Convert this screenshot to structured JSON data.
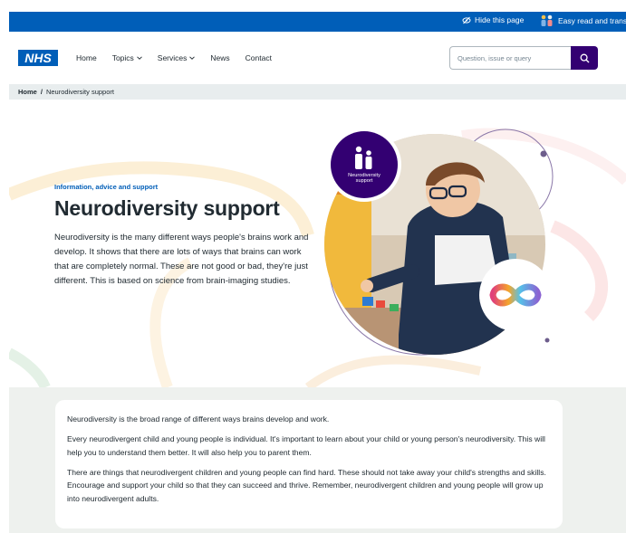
{
  "topbar": {
    "hide_label": "Hide this page",
    "easy_read_label": "Easy read and translat"
  },
  "header": {
    "logo_text": "NHS",
    "nav": [
      "Home",
      "Topics",
      "Services",
      "News",
      "Contact"
    ],
    "search_placeholder": "Question, issue or query"
  },
  "breadcrumb": {
    "home": "Home",
    "separator": "/",
    "current": "Neurodiversity support"
  },
  "hero": {
    "kicker": "Information, advice and support",
    "title": "Neurodiversity support",
    "lead": "Neurodiversity is the many different ways people's brains work and develop. It shows that there are lots of ways that brains can work that are completely normal. These are not good or bad, they're just different. This is based on science from brain-imaging studies.",
    "badge_label": "Neurodiversity support"
  },
  "content": {
    "paragraphs": [
      "Neurodiversity is the broad range of different ways brains develop and work.",
      "Every neurodivergent child and young people is individual. It's important to learn about your child or young person's neurodiversity. This will help you to understand them better. It will also help you to parent them.",
      "There are things that neurodivergent children and young people can find hard. These should not take away your child's strengths and skills. Encourage and support your child so that they can succeed and thrive.  Remember, neurodivergent children and young people will grow up into neurodivergent adults."
    ]
  },
  "colors": {
    "nhs_blue": "#005eb8",
    "purple": "#330072",
    "breadcrumb_bg": "#e8edee",
    "lower_bg": "#eef1ee"
  },
  "icons": [
    "eye-slash-icon",
    "people-icon",
    "chevron-down-icon",
    "search-icon",
    "neurodiversity-badge-icon",
    "infinity-icon"
  ]
}
